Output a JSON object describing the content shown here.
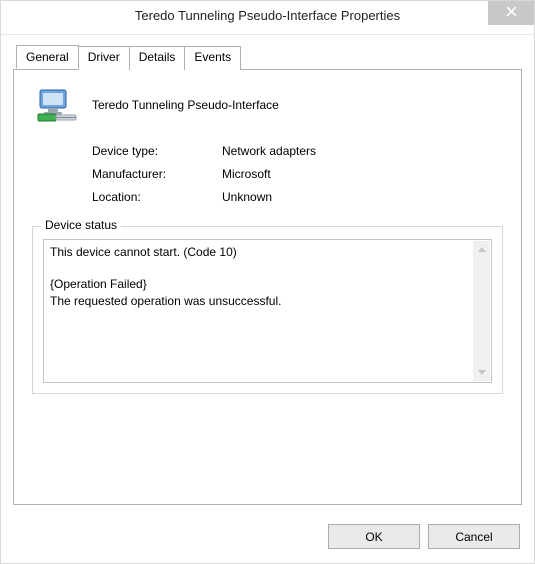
{
  "window": {
    "title": "Teredo Tunneling Pseudo-Interface Properties"
  },
  "tabs": {
    "general": "General",
    "driver": "Driver",
    "details": "Details",
    "events": "Events"
  },
  "general": {
    "device_name": "Teredo Tunneling Pseudo-Interface",
    "rows": {
      "device_type_label": "Device type:",
      "device_type_value": "Network adapters",
      "manufacturer_label": "Manufacturer:",
      "manufacturer_value": "Microsoft",
      "location_label": "Location:",
      "location_value": "Unknown"
    },
    "status_legend": "Device status",
    "status_text": "This device cannot start. (Code 10)\n\n{Operation Failed}\nThe requested operation was unsuccessful."
  },
  "buttons": {
    "ok": "OK",
    "cancel": "Cancel"
  }
}
